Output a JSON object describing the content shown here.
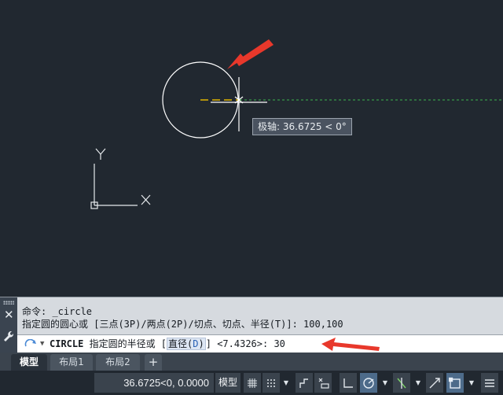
{
  "viewport": {
    "ucs": {
      "x_label": "X",
      "y_label": "Y"
    },
    "tooltip": "极轴: 36.6725 < 0°",
    "colors": {
      "background": "#212830",
      "circle": "#ffffff",
      "polar_track": "#3cb44b",
      "snap_marker": "#e0b400",
      "annotation_arrow": "#e8382b"
    }
  },
  "command": {
    "history": [
      {
        "prefix": "命令: ",
        "text": "_circle"
      },
      {
        "prefix": "",
        "text": "指定圆的圆心或 [三点(3P)/两点(2P)/切点、切点、半径(T)]: 100,100"
      }
    ],
    "prompt_cmd": "CIRCLE",
    "prompt_text": " 指定圆的半径或 [",
    "option_label": "直径(",
    "option_hotkey": "D",
    "option_close": ")",
    "prompt_tail": "] <7.4326>:  ",
    "input_value": "30"
  },
  "tabs": [
    {
      "label": "模型",
      "active": true
    },
    {
      "label": "布局1",
      "active": false
    },
    {
      "label": "布局2",
      "active": false
    }
  ],
  "status": {
    "coords": "36.6725<0, 0.0000",
    "space": "模型"
  }
}
